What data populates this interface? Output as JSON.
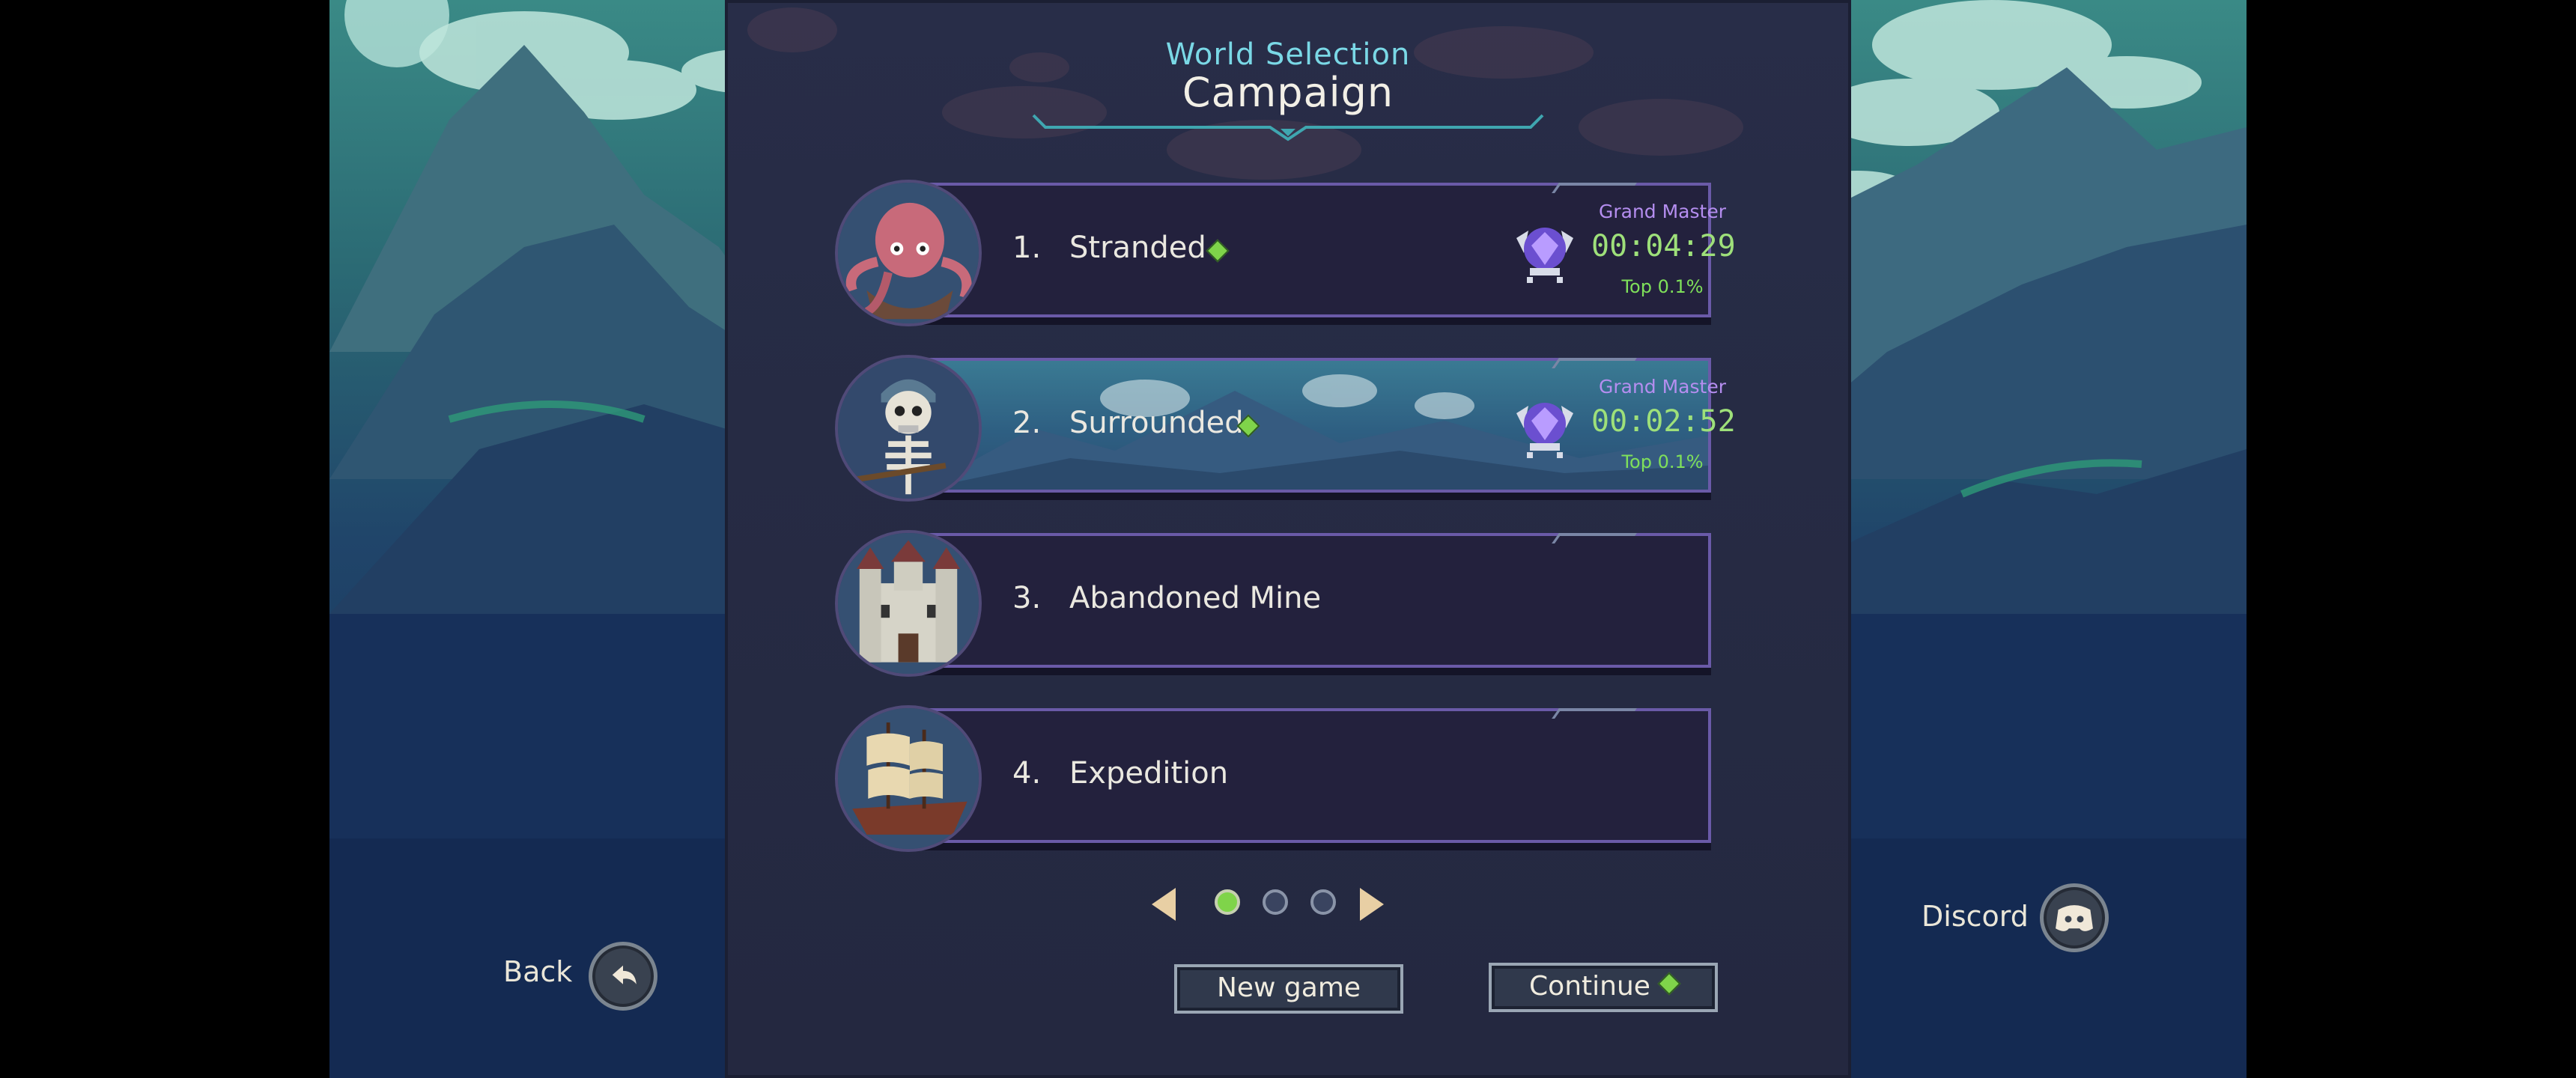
{
  "header": {
    "subtitle": "World Selection",
    "title": "Campaign"
  },
  "worlds": [
    {
      "number": "1.",
      "name": "Stranded",
      "completed": true,
      "rank": "Grand Master",
      "time": "00:04:29",
      "percentile": "Top 0.1%",
      "avatar": "octopus-icon"
    },
    {
      "number": "2.",
      "name": "Surrounded",
      "completed": true,
      "rank": "Grand Master",
      "time": "00:02:52",
      "percentile": "Top 0.1%",
      "avatar": "skeleton-icon",
      "selected": true
    },
    {
      "number": "3.",
      "name": "Abandoned Mine",
      "completed": false,
      "avatar": "castle-icon"
    },
    {
      "number": "4.",
      "name": "Expedition",
      "completed": false,
      "avatar": "ship-icon"
    }
  ],
  "pager": {
    "pages": 3,
    "current": 1
  },
  "buttons": {
    "new_game": "New game",
    "continue": "Continue"
  },
  "side": {
    "back": "Back",
    "discord": "Discord"
  },
  "colors": {
    "accent_green": "#7fd44a",
    "rank_purple": "#b58ef0",
    "title_cyan": "#7ad8e6"
  }
}
